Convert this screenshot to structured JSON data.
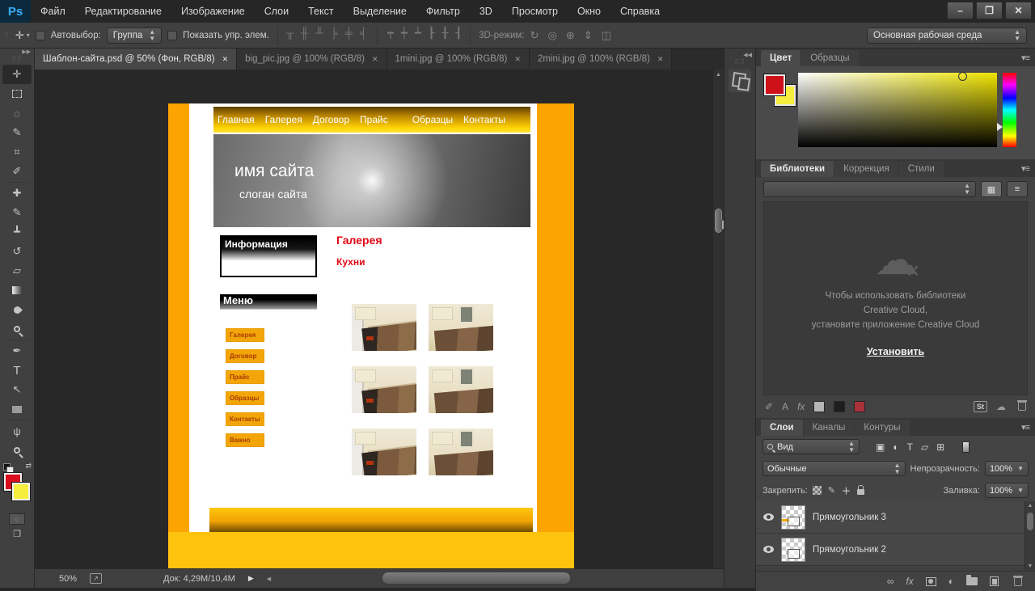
{
  "app": {
    "logo": "Ps"
  },
  "menubar": {
    "items": [
      "Файл",
      "Редактирование",
      "Изображение",
      "Слои",
      "Текст",
      "Выделение",
      "Фильтр",
      "3D",
      "Просмотр",
      "Окно",
      "Справка"
    ]
  },
  "window_buttons": {
    "minimize": "–",
    "restore": "❐",
    "close": "✕"
  },
  "options_bar": {
    "autoselect_label": "Автовыбор:",
    "autoselect_value": "Группа",
    "show_controls_label": "Показать упр. элем.",
    "threed_label": "3D-режим:",
    "workspace_value": "Основная рабочая среда",
    "align_icons": [
      "align-top",
      "align-vcenter",
      "align-bottom",
      "align-left",
      "align-hcenter",
      "align-right",
      "dist-top",
      "dist-vcenter",
      "dist-bottom",
      "dist-left",
      "dist-hcenter",
      "dist-right"
    ],
    "threed_icons": [
      "3d-rotate",
      "3d-roll",
      "3d-drag",
      "3d-slide",
      "3d-scale"
    ]
  },
  "tabs": [
    {
      "label": "Шаблон-сайта.psd @ 50% (Фон, RGB/8)",
      "close": "✕"
    },
    {
      "label": "big_pic.jpg @ 100% (RGB/8)",
      "close": "✕"
    },
    {
      "label": "1mini.jpg @ 100% (RGB/8)",
      "close": "✕"
    },
    {
      "label": "2mini.jpg @ 100% (RGB/8)",
      "close": "✕"
    }
  ],
  "toolbar": {
    "tools": [
      "move",
      "rectangular-marquee",
      "lasso",
      "quick-selection",
      "crop",
      "eyedropper",
      "spot-healing-brush",
      "brush",
      "clone-stamp",
      "history-brush",
      "eraser",
      "gradient",
      "blur",
      "dodge",
      "pen",
      "type",
      "path-selection",
      "rectangle-shape",
      "hand",
      "zoom"
    ],
    "foreground_color": "#d90f1d",
    "background_color": "#f6ee3e"
  },
  "site": {
    "nav": [
      "Главная",
      "Галерея",
      "Договор",
      "Прайс",
      "Образцы",
      "Контакты"
    ],
    "name": "имя сайта",
    "slogan": "слоган сайта",
    "info_title": "Информация",
    "menu_title": "Меню",
    "menu_buttons": [
      "Галерея",
      "Договор",
      "Прайс",
      "Образцы",
      "Контакты",
      "Важно"
    ],
    "gallery_title": "Галерея",
    "gallery_subtitle": "Кухни",
    "colors": {
      "side_strip": "#fba402",
      "page_bg": "#fdc30e",
      "nav_top": "#5e3e00",
      "nav_bottom": "#ffe33a",
      "heading_red": "#e30613"
    }
  },
  "color_panel": {
    "tabs": [
      "Цвет",
      "Образцы"
    ],
    "foreground": "#ce1019",
    "background": "#f6ee3e"
  },
  "libraries_panel": {
    "tabs": [
      "Библиотеки",
      "Коррекция",
      "Стили"
    ],
    "message_line1": "Чтобы использовать библиотеки",
    "message_line2": "Creative Cloud,",
    "message_line3": "установите приложение Creative Cloud",
    "install_link": "Установить",
    "st_badge": "St"
  },
  "layers_panel": {
    "tabs": [
      "Слои",
      "Каналы",
      "Контуры"
    ],
    "filter_value": "Вид",
    "blend_mode": "Обычные",
    "opacity_label": "Непрозрачность:",
    "opacity_value": "100%",
    "lock_label": "Закрепить:",
    "fill_label": "Заливка:",
    "fill_value": "100%",
    "layers": [
      {
        "name": "Прямоугольник 3"
      },
      {
        "name": "Прямоугольник 2"
      }
    ]
  },
  "statusbar": {
    "zoom": "50%",
    "doc_info": "Док: 4,29M/10,4M"
  }
}
